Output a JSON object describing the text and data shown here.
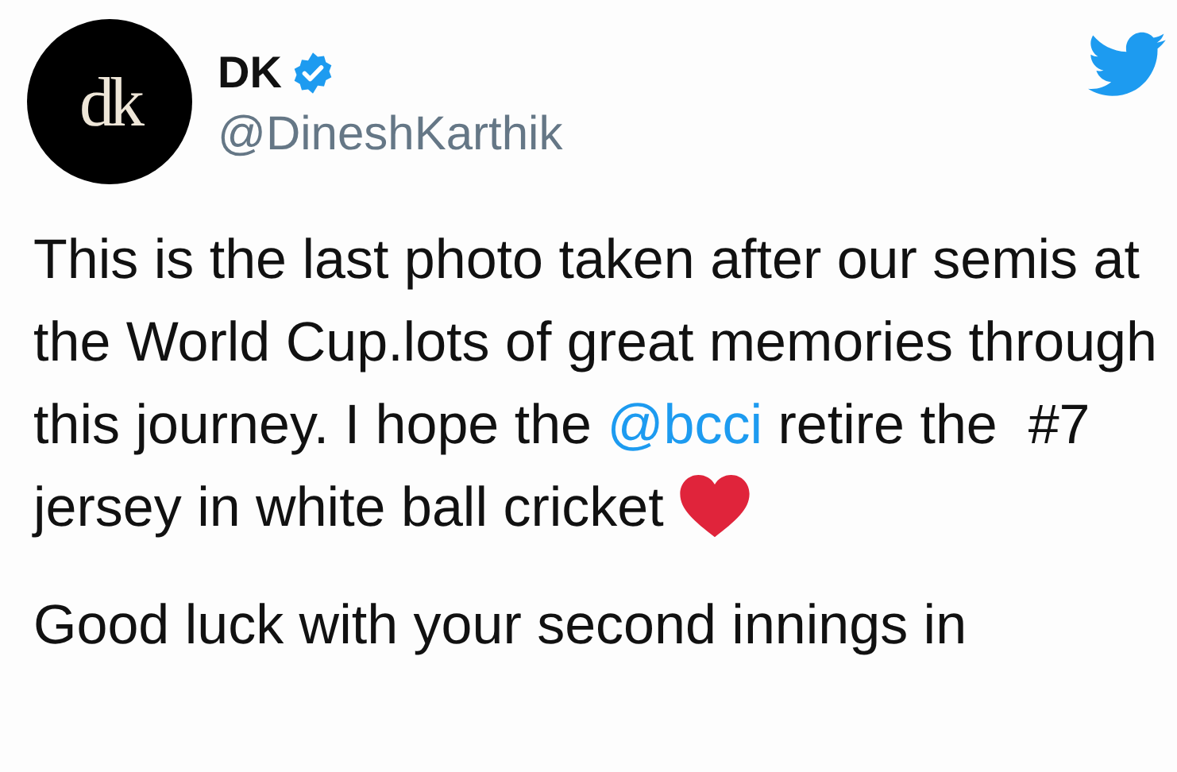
{
  "author": {
    "avatar_text": "dk",
    "name": "DK",
    "verified": true,
    "handle": "@DineshKarthik"
  },
  "tweet": {
    "paragraphs": [
      {
        "segments": [
          {
            "kind": "text",
            "text": "This is the last photo taken after our semis at the World Cup.lots of great memories through this journey. I hope the "
          },
          {
            "kind": "mention",
            "text": "@bcci"
          },
          {
            "kind": "text",
            "text": " retire the  #7 jersey in white ball cricket "
          },
          {
            "kind": "heart"
          }
        ]
      },
      {
        "segments": [
          {
            "kind": "text",
            "text": "Good luck with your second innings in"
          }
        ]
      }
    ]
  }
}
